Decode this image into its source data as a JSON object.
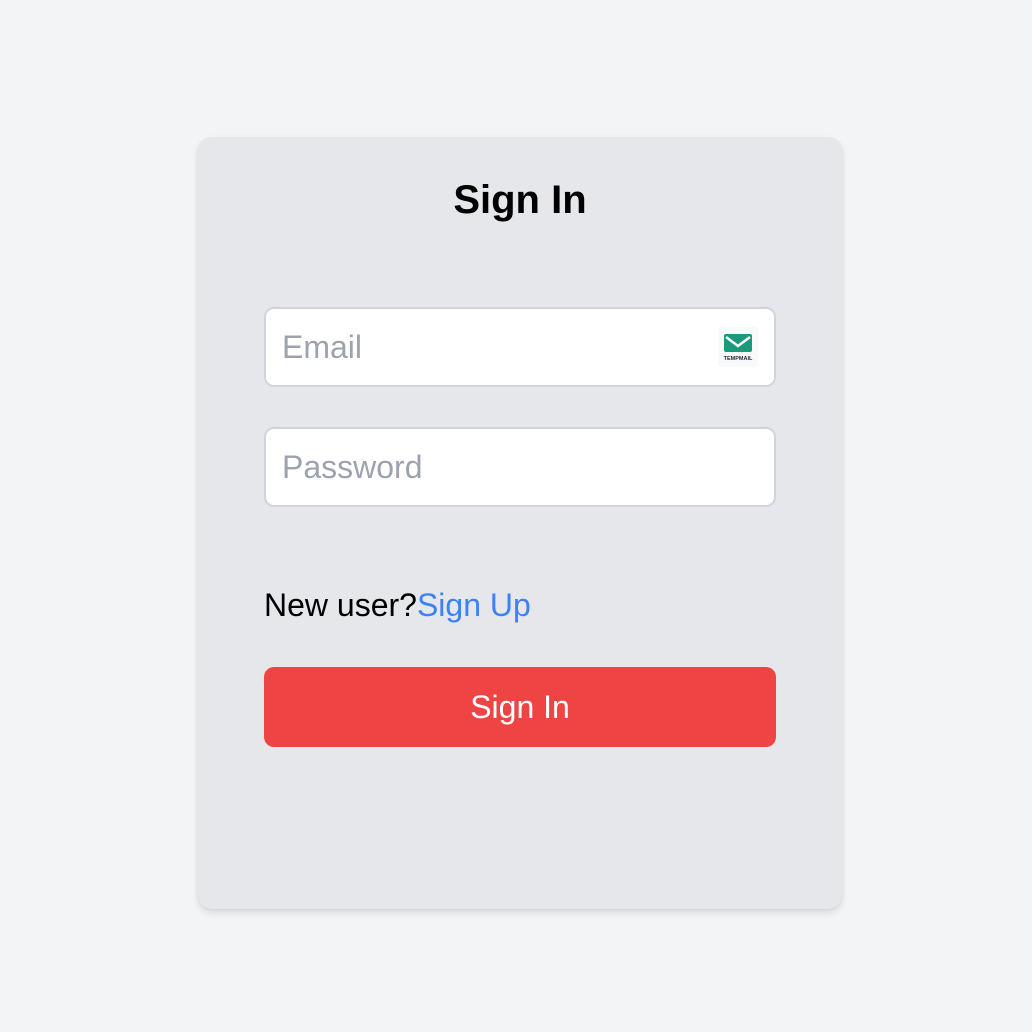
{
  "form": {
    "title": "Sign In",
    "email": {
      "value": "",
      "placeholder": "Email",
      "extension_icon": "tempmail-envelope-icon",
      "extension_icon_text": "TEMPMAIL"
    },
    "password": {
      "value": "",
      "placeholder": "Password"
    },
    "signup_prompt": "New user?",
    "signup_link": "Sign Up",
    "submit_label": "Sign In"
  },
  "colors": {
    "page_background": "#f3f4f6",
    "card_background": "#e5e7eb",
    "link": "#3b82f6",
    "submit_button": "#ef4444",
    "tempmail_green": "#1a9a7a"
  }
}
